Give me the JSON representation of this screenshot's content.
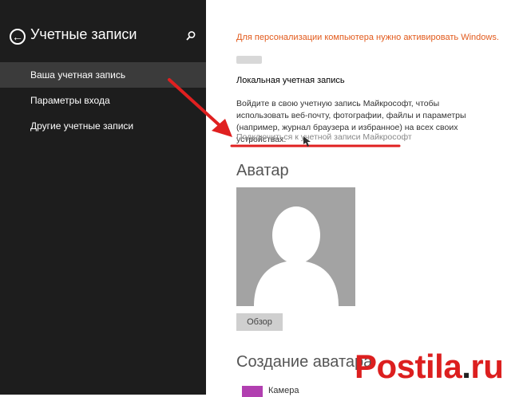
{
  "sidebar": {
    "title": "Учетные записи",
    "back_icon": "back-arrow-icon",
    "search_icon": "search-icon",
    "items": [
      {
        "label": "Ваша учетная запись",
        "selected": true
      },
      {
        "label": "Параметры входа",
        "selected": false
      },
      {
        "label": "Другие учетные записи",
        "selected": false
      }
    ]
  },
  "main": {
    "activation_warning": "Для персонализации компьютера нужно активировать Windows.",
    "account_type": "Локальная учетная запись",
    "description": "Войдите в свою учетную запись Майкрософт, чтобы использовать веб-почту, фотографии, файлы и параметры (например, журнал браузера и избранное) на всех своих устройствах.",
    "connect_link": "Подключиться к учетной записи Майкрософт",
    "avatar_section_title": "Аватар",
    "browse_button": "Обзор",
    "create_avatar_title": "Создание аватара",
    "camera_label": "Камера"
  },
  "watermark": {
    "left": "Postila",
    "mid": ".",
    "right": "ru"
  },
  "colors": {
    "sidebar_bg": "#1d1d1d",
    "selected_item_bg": "#3b3b3b",
    "warning": "#e25a1c",
    "annotation_red": "#e02020",
    "avatar_bg": "#a3a3a3",
    "camera_tile": "#b13fb0"
  }
}
